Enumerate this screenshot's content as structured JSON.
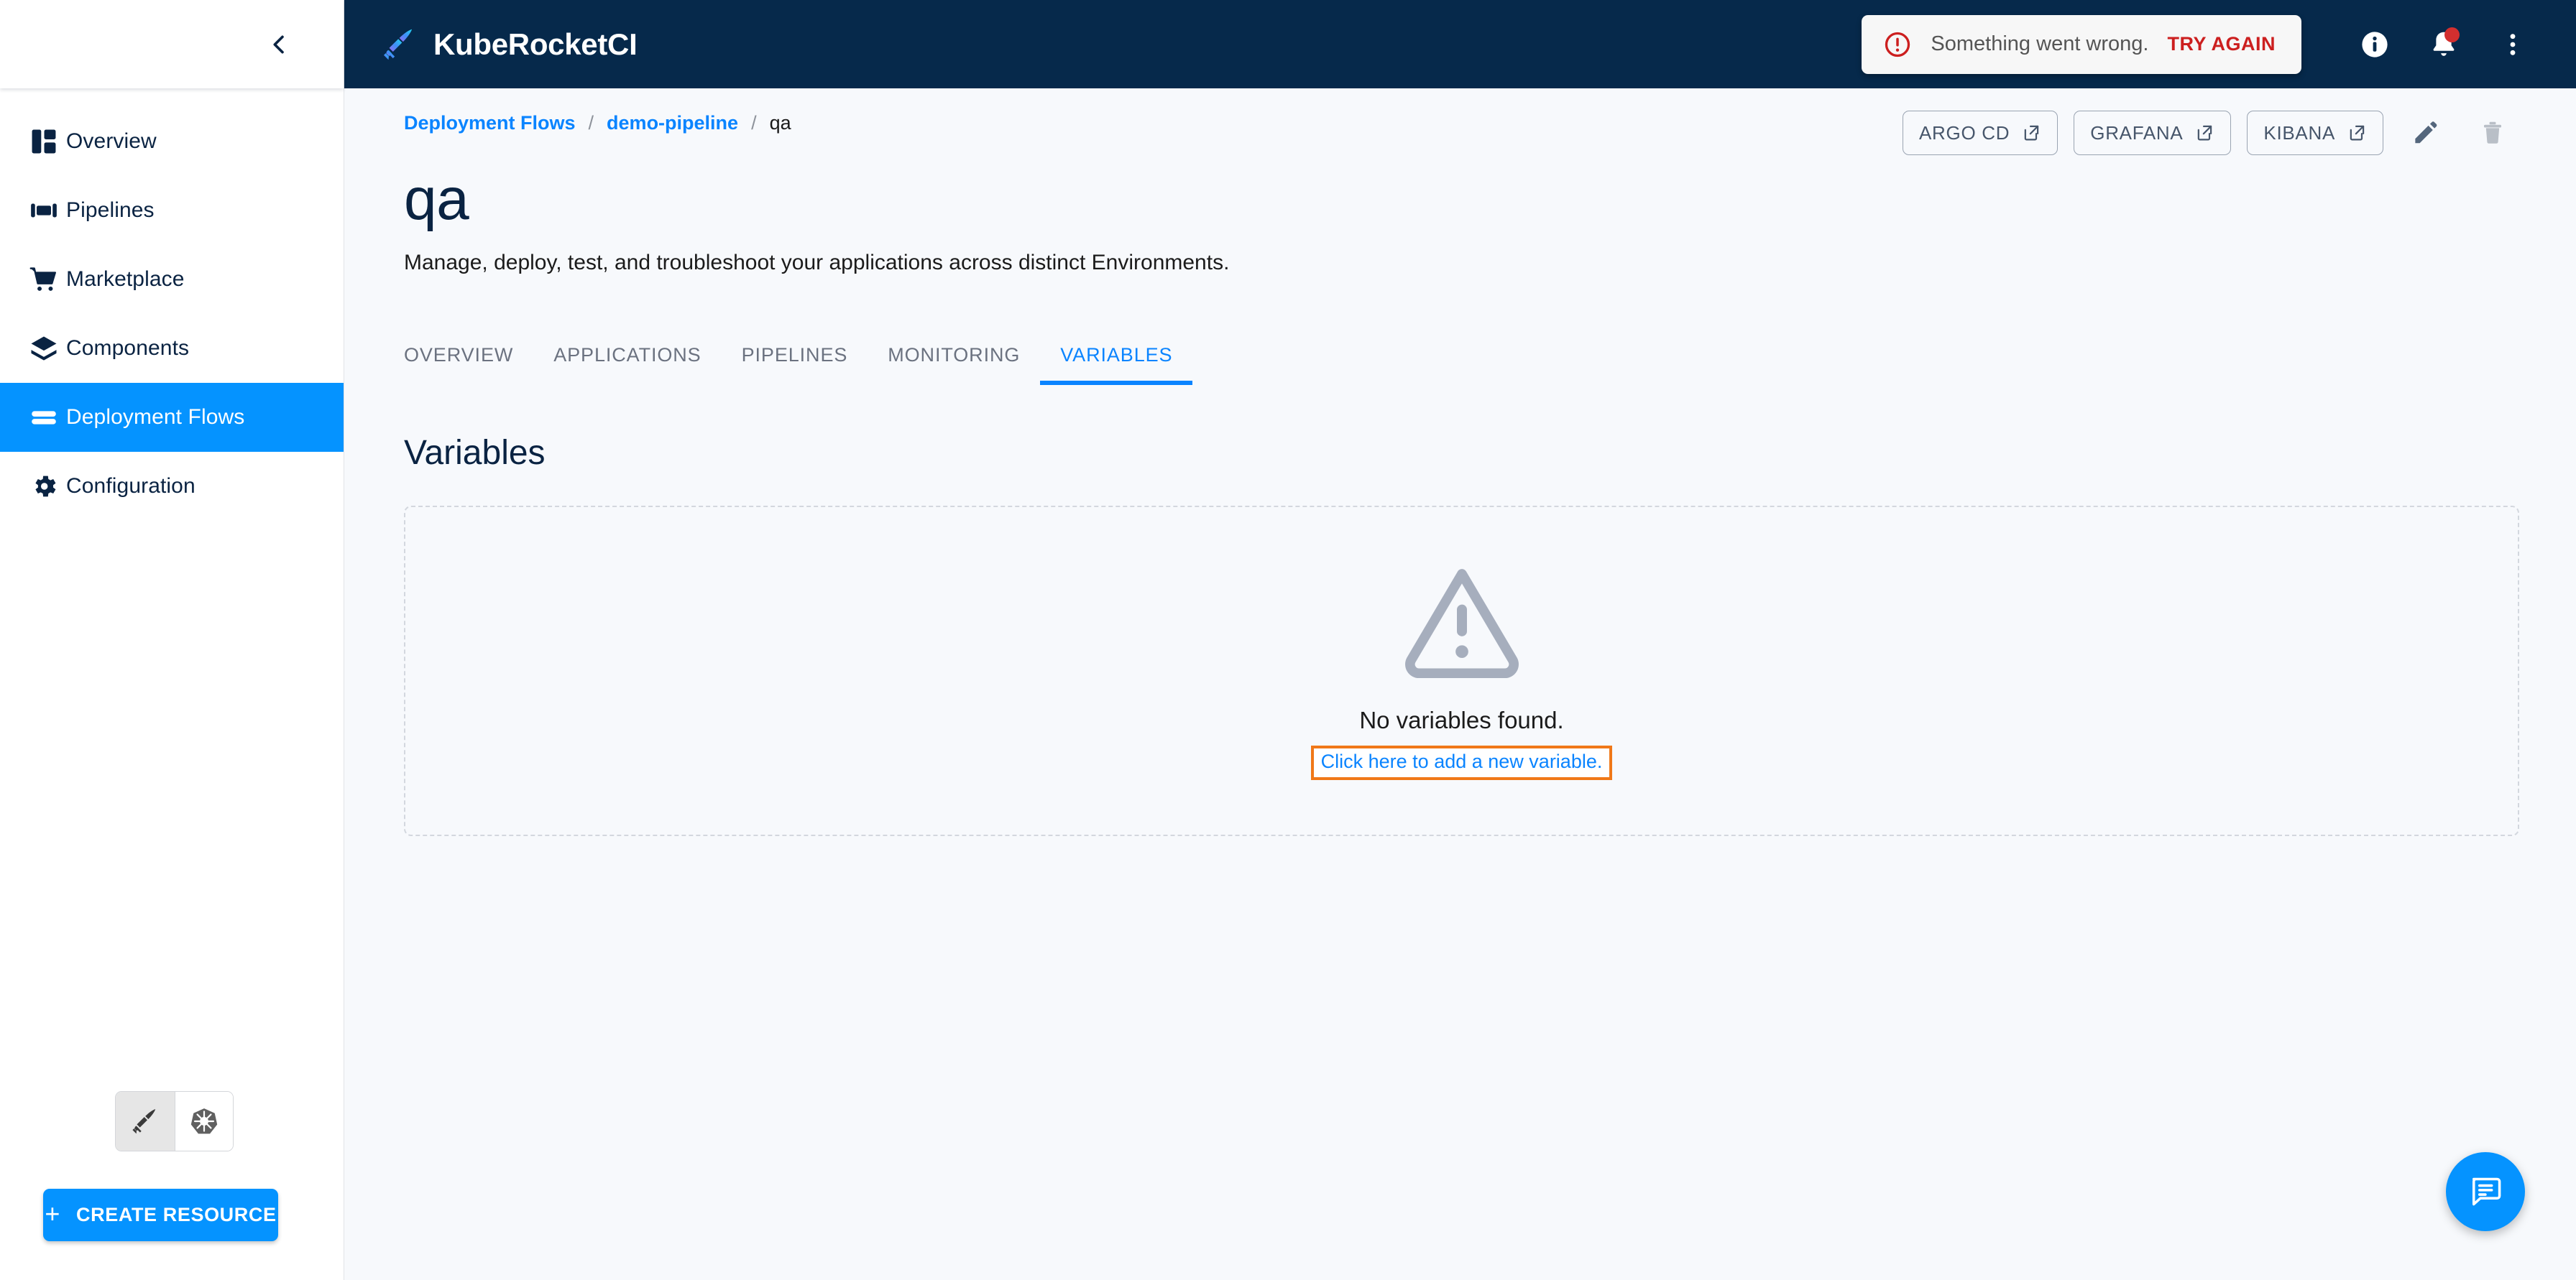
{
  "app": {
    "brand_name": "KubeRocketCI",
    "accent_color": "#0593ff",
    "appbar_color": "#06294b",
    "link_color": "#0a84ff",
    "highlight_color": "#f07818"
  },
  "sidebar": {
    "collapse_icon": "chevron-left-icon",
    "items": [
      {
        "label": "Overview",
        "icon": "dashboard-icon",
        "active": false
      },
      {
        "label": "Pipelines",
        "icon": "pipelines-icon",
        "active": false
      },
      {
        "label": "Marketplace",
        "icon": "shopping-cart-icon",
        "active": false
      },
      {
        "label": "Components",
        "icon": "layers-icon",
        "active": false
      },
      {
        "label": "Deployment Flows",
        "icon": "deployment-flows-icon",
        "active": true
      },
      {
        "label": "Configuration",
        "icon": "gear-icon",
        "active": false
      }
    ],
    "cluster_toggle": [
      {
        "icon": "kuberocketci-logo-icon",
        "selected": true
      },
      {
        "icon": "kubernetes-helm-icon",
        "selected": false
      }
    ],
    "create_resource_label": "CREATE RESOURCE",
    "create_resource_icon": "plus-icon"
  },
  "appbar": {
    "error_toast": {
      "icon": "error-circle-icon",
      "message": "Something went wrong.",
      "action_label": "TRY AGAIN"
    },
    "icons": [
      {
        "name": "info-icon",
        "badge": false
      },
      {
        "name": "notifications-bell-icon",
        "badge": true
      },
      {
        "name": "more-vertical-icon",
        "badge": false
      }
    ]
  },
  "breadcrumb": {
    "separator": "/",
    "items": [
      {
        "label": "Deployment Flows",
        "current": false
      },
      {
        "label": "demo-pipeline",
        "current": false
      },
      {
        "label": "qa",
        "current": true
      }
    ]
  },
  "header_actions": {
    "links": [
      {
        "label": "ARGO CD",
        "icon": "external-link-icon"
      },
      {
        "label": "GRAFANA",
        "icon": "external-link-icon"
      },
      {
        "label": "KIBANA",
        "icon": "external-link-icon"
      }
    ],
    "edit_icon": "pencil-icon",
    "delete_icon": "trash-icon"
  },
  "page": {
    "title": "qa",
    "description": "Manage, deploy, test, and troubleshoot your applications across distinct Environments."
  },
  "tabs": [
    {
      "label": "OVERVIEW",
      "active": false
    },
    {
      "label": "APPLICATIONS",
      "active": false
    },
    {
      "label": "PIPELINES",
      "active": false
    },
    {
      "label": "MONITORING",
      "active": false
    },
    {
      "label": "VARIABLES",
      "active": true
    }
  ],
  "variables_section": {
    "title": "Variables",
    "empty_state": {
      "icon": "warning-triangle-icon",
      "title": "No variables found.",
      "link_label": "Click here to add a new variable."
    }
  },
  "chat": {
    "icon": "chat-bubble-icon"
  }
}
